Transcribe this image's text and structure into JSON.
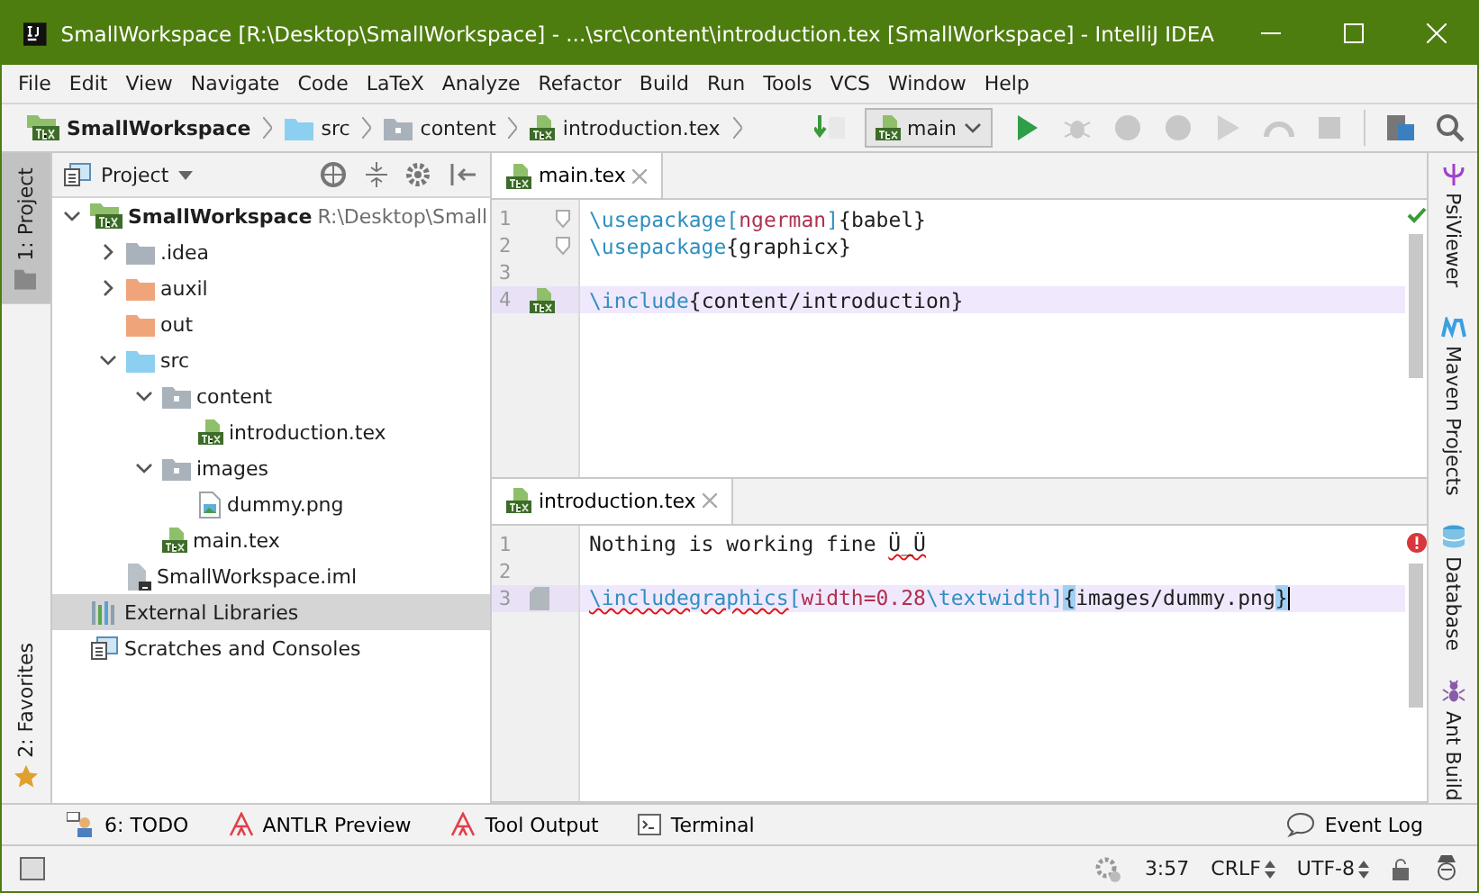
{
  "window": {
    "title": "SmallWorkspace [R:\\Desktop\\SmallWorkspace] - ...\\src\\content\\introduction.tex [SmallWorkspace] - IntelliJ IDEA"
  },
  "menu": [
    "File",
    "Edit",
    "View",
    "Navigate",
    "Code",
    "LaTeX",
    "Analyze",
    "Refactor",
    "Build",
    "Run",
    "Tools",
    "VCS",
    "Window",
    "Help"
  ],
  "breadcrumbs": [
    {
      "label": "SmallWorkspace",
      "kind": "module"
    },
    {
      "label": "src",
      "kind": "source"
    },
    {
      "label": "content",
      "kind": "folder"
    },
    {
      "label": "introduction.tex",
      "kind": "tex"
    }
  ],
  "run_config": {
    "label": "main"
  },
  "left_stripe": [
    {
      "label": "1: Project",
      "selected": true
    },
    {
      "label": "2: Favorites",
      "selected": false
    }
  ],
  "project_panel": {
    "title": "Project",
    "tree": [
      {
        "label": "SmallWorkspace",
        "path": "R:\\Desktop\\Small",
        "kind": "module",
        "expanded": true,
        "selected": false,
        "children": [
          {
            "label": ".idea",
            "kind": "folder",
            "expanded": false,
            "selected": false
          },
          {
            "label": "auxil",
            "kind": "excluded",
            "expanded": false,
            "selected": false
          },
          {
            "label": "out",
            "kind": "excluded",
            "selected": false
          },
          {
            "label": "src",
            "kind": "source",
            "expanded": true,
            "selected": false,
            "children": [
              {
                "label": "content",
                "kind": "package",
                "expanded": true,
                "selected": false,
                "children": [
                  {
                    "label": "introduction.tex",
                    "kind": "tex",
                    "selected": false
                  }
                ]
              },
              {
                "label": "images",
                "kind": "package",
                "expanded": true,
                "selected": false,
                "children": [
                  {
                    "label": "dummy.png",
                    "kind": "image",
                    "selected": false
                  }
                ]
              },
              {
                "label": "main.tex",
                "kind": "tex",
                "selected": false
              }
            ]
          },
          {
            "label": "SmallWorkspace.iml",
            "kind": "iml",
            "selected": false
          }
        ]
      },
      {
        "label": "External Libraries",
        "kind": "libraries",
        "selected": true
      },
      {
        "label": "Scratches and Consoles",
        "kind": "scratches",
        "selected": false
      }
    ]
  },
  "editors": [
    {
      "tab": {
        "label": "main.tex",
        "selected": true
      },
      "inspection": {
        "kind": "ok"
      },
      "lines": [
        {
          "number": "1",
          "current": false,
          "gutter": {
            "kind": "fold"
          },
          "tokens": [
            {
              "kind": "command",
              "text": "\\usepackage"
            },
            {
              "kind": "bracket",
              "text": "["
            },
            {
              "kind": "option",
              "text": "ngerman"
            },
            {
              "kind": "bracket",
              "text": "]"
            },
            {
              "kind": "plain",
              "text": "{babel}"
            }
          ]
        },
        {
          "number": "2",
          "current": false,
          "gutter": {
            "kind": "fold"
          },
          "tokens": [
            {
              "kind": "command",
              "text": "\\usepackage"
            },
            {
              "kind": "plain",
              "text": "{graphicx}"
            }
          ]
        },
        {
          "number": "3",
          "current": false
        },
        {
          "number": "4",
          "current": true,
          "gutter": {
            "kind": "tex"
          },
          "tokens": [
            {
              "kind": "command",
              "text": "\\include"
            },
            {
              "kind": "plain",
              "text": "{content/introduction}"
            }
          ]
        }
      ]
    },
    {
      "tab": {
        "label": "introduction.tex",
        "selected": true
      },
      "inspection": {
        "kind": "error"
      },
      "lines": [
        {
          "number": "1",
          "current": false,
          "tokens": [
            {
              "kind": "plain",
              "text": "Nothing is working fine "
            },
            {
              "kind": "plain",
              "text": "Ü_Ü",
              "squiggle": true
            }
          ]
        },
        {
          "number": "2",
          "current": false
        },
        {
          "number": "3",
          "current": true,
          "gutter": {
            "kind": "file"
          },
          "tokens": [
            {
              "kind": "command",
              "text": "\\includegraphics",
              "squiggle": true
            },
            {
              "kind": "bracket",
              "text": "["
            },
            {
              "kind": "option",
              "text": "width=0.28"
            },
            {
              "kind": "command",
              "text": "\\textwidth"
            },
            {
              "kind": "bracket",
              "text": "]"
            },
            {
              "kind": "plain",
              "text": "{",
              "matched": true
            },
            {
              "kind": "plain",
              "text": "images/dummy.png"
            },
            {
              "kind": "plain",
              "text": "}",
              "matched": true
            }
          ]
        }
      ]
    }
  ],
  "right_stripe": [
    {
      "label": "PsiViewer",
      "kind": "psi"
    },
    {
      "label": "Maven Projects",
      "kind": "maven"
    },
    {
      "label": "Database",
      "kind": "database"
    },
    {
      "label": "Ant Build",
      "kind": "ant"
    }
  ],
  "bottom_tools": [
    {
      "label": "6: TODO",
      "kind": "todo"
    },
    {
      "label": "ANTLR Preview",
      "kind": "antlr"
    },
    {
      "label": "Tool Output",
      "kind": "antlr"
    },
    {
      "label": "Terminal",
      "kind": "terminal"
    }
  ],
  "event_log": "Event Log",
  "status_bar": {
    "position": "3:57",
    "line_separator": "CRLF",
    "encoding": "UTF-8"
  }
}
